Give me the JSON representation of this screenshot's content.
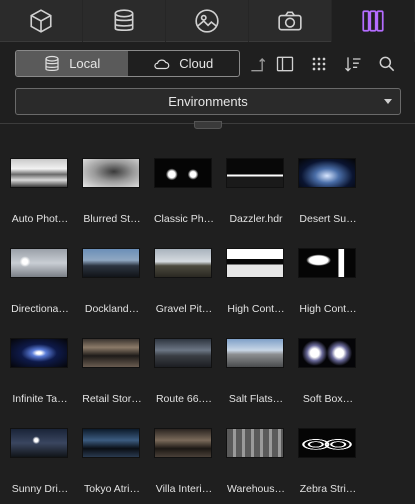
{
  "tabs": [
    {
      "icon": "cube-icon",
      "active": false
    },
    {
      "icon": "database-icon",
      "active": false
    },
    {
      "icon": "image-icon",
      "active": false
    },
    {
      "icon": "camera-icon",
      "active": false
    },
    {
      "icon": "columns-icon",
      "active": true
    }
  ],
  "toolbar": {
    "local_label": "Local",
    "cloud_label": "Cloud",
    "accent": "#b46cff"
  },
  "dropdown": {
    "value": "Environments"
  },
  "items": [
    {
      "label": "Auto Phot…"
    },
    {
      "label": "Blurred St…"
    },
    {
      "label": "Classic Ph…"
    },
    {
      "label": "Dazzler.hdr"
    },
    {
      "label": "Desert Su…"
    },
    {
      "label": "Directiona…"
    },
    {
      "label": "Dockland…"
    },
    {
      "label": "Gravel Pit…"
    },
    {
      "label": "High Cont…"
    },
    {
      "label": "High Cont…"
    },
    {
      "label": "Infinite Ta…"
    },
    {
      "label": "Retail Stor…"
    },
    {
      "label": "Route 66.…"
    },
    {
      "label": "Salt Flats…"
    },
    {
      "label": "Soft Box…"
    },
    {
      "label": "Sunny Dri…"
    },
    {
      "label": "Tokyo Atri…"
    },
    {
      "label": "Villa Interi…"
    },
    {
      "label": "Warehous…"
    },
    {
      "label": "Zebra Stri…"
    }
  ]
}
